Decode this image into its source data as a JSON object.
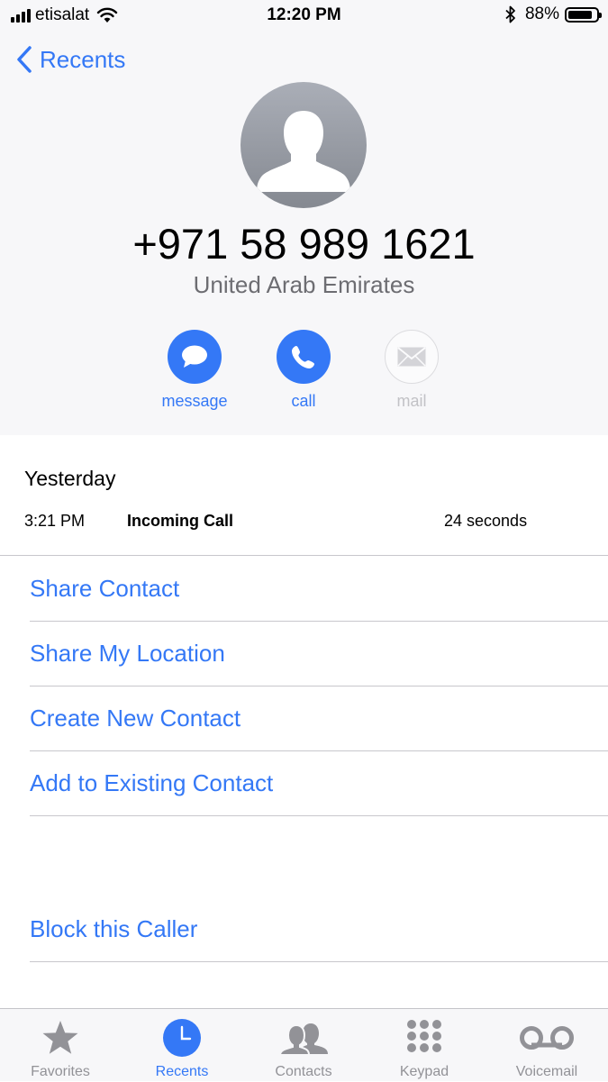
{
  "status_bar": {
    "carrier": "etisalat",
    "time": "12:20 PM",
    "battery_percent": "88%",
    "battery_level": 0.88,
    "icons": [
      "signal-icon",
      "wifi-icon",
      "bluetooth-icon",
      "battery-icon"
    ]
  },
  "nav": {
    "back_label": "Recents"
  },
  "contact": {
    "phone_number": "+971 58 989 1621",
    "country": "United Arab Emirates"
  },
  "actions": {
    "message_label": "message",
    "call_label": "call",
    "mail_label": "mail",
    "mail_enabled": false
  },
  "call_log": {
    "date": "Yesterday",
    "entries": [
      {
        "time": "3:21 PM",
        "type": "Incoming Call",
        "duration": "24 seconds"
      }
    ]
  },
  "menu": {
    "share_contact": "Share Contact",
    "share_location": "Share My Location",
    "create_contact": "Create New Contact",
    "add_existing": "Add to Existing Contact",
    "block_caller": "Block this Caller"
  },
  "tabs": [
    {
      "label": "Favorites",
      "icon": "star-icon"
    },
    {
      "label": "Recents",
      "icon": "clock-icon",
      "active": true
    },
    {
      "label": "Contacts",
      "icon": "contacts-icon"
    },
    {
      "label": "Keypad",
      "icon": "keypad-icon"
    },
    {
      "label": "Voicemail",
      "icon": "voicemail-icon"
    }
  ],
  "colors": {
    "accent": "#3478f6",
    "inactive": "#929297",
    "header_bg": "#f7f7f9"
  }
}
